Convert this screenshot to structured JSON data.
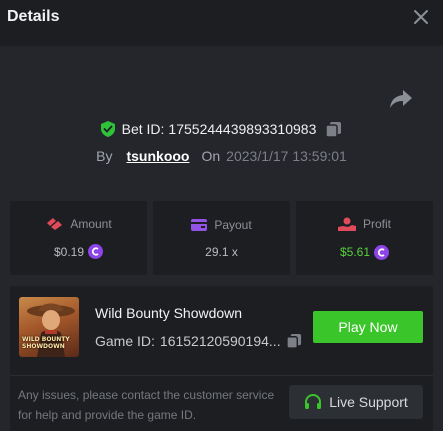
{
  "header": {
    "title": "Details",
    "close_icon": "close-icon"
  },
  "bet": {
    "id_label": "Bet ID:",
    "id_value": "17552444398933109​83",
    "by_label": "By",
    "username": "tsunkooo",
    "on_label": "On",
    "datetime": "2023/1/17 13:59:01"
  },
  "stats": {
    "amount": {
      "label": "Amount",
      "value": "$0.19",
      "icon": "bet-chips-icon",
      "color": "#e04a5a"
    },
    "payout": {
      "label": "Payout",
      "value": "29.1 x",
      "icon": "wallet-icon",
      "color": "#9354e6"
    },
    "profit": {
      "label": "Profit",
      "value": "$5.61",
      "icon": "profit-hand-icon",
      "color": "#e04a5a",
      "value_color": "#56d33c"
    }
  },
  "game": {
    "name": "Wild Bounty Showdown",
    "id_label": "Game ID:",
    "id_value": "16152120590194...",
    "thumb_text": "WILD BOUNTY SHOWDOWN",
    "play_label": "Play Now"
  },
  "support": {
    "notice": "Any issues, please contact the customer service for help and provide the game ID.",
    "button_label": "Live Support"
  },
  "colors": {
    "accent_green": "#3ac52a",
    "coin_purple": "#8d45e8",
    "shield_green": "#2fc138"
  }
}
